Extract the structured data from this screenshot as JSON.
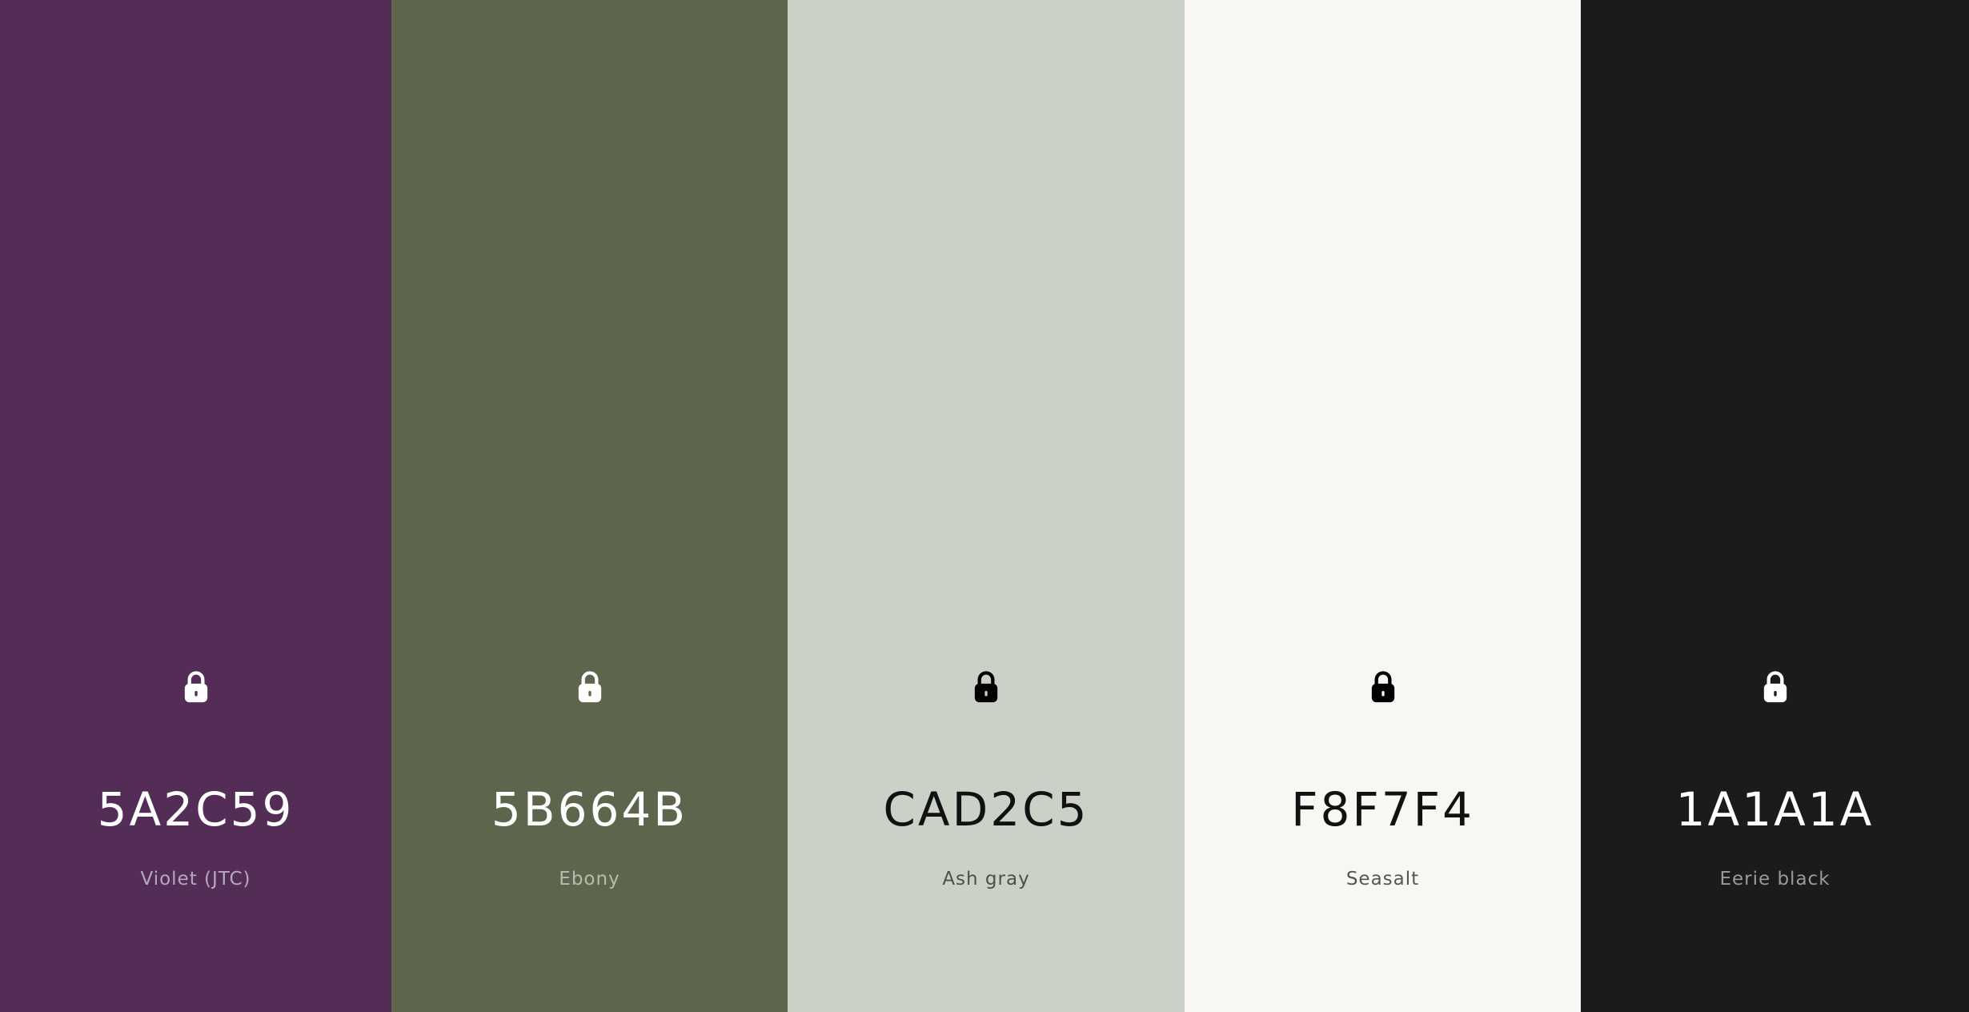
{
  "palette": {
    "colors": [
      {
        "hex": "5A2C59",
        "name": "Violet (JTC)",
        "background": "#532d56",
        "text_color": "#ffffff",
        "name_color": "#b9a8bb",
        "lock_icon": "lock-icon",
        "lock_color": "#ffffff"
      },
      {
        "hex": "5B664B",
        "name": "Ebony",
        "background": "#5e654d",
        "text_color": "#ffffff",
        "name_color": "#b7bcae",
        "lock_icon": "lock-icon",
        "lock_color": "#ffffff"
      },
      {
        "hex": "CAD2C5",
        "name": "Ash gray",
        "background": "#cbd1c6",
        "text_color": "#111111",
        "name_color": "#4c4f4a",
        "lock_icon": "lock-icon",
        "lock_color": "#000000"
      },
      {
        "hex": "F8F7F4",
        "name": "Seasalt",
        "background": "#f8f7f4",
        "text_color": "#111111",
        "name_color": "#555555",
        "lock_icon": "lock-icon",
        "lock_color": "#000000"
      },
      {
        "hex": "1A1A1A",
        "name": "Eerie black",
        "background": "#1b1b1b",
        "text_color": "#ffffff",
        "name_color": "#9a9a9a",
        "lock_icon": "lock-icon",
        "lock_color": "#ffffff"
      }
    ]
  }
}
